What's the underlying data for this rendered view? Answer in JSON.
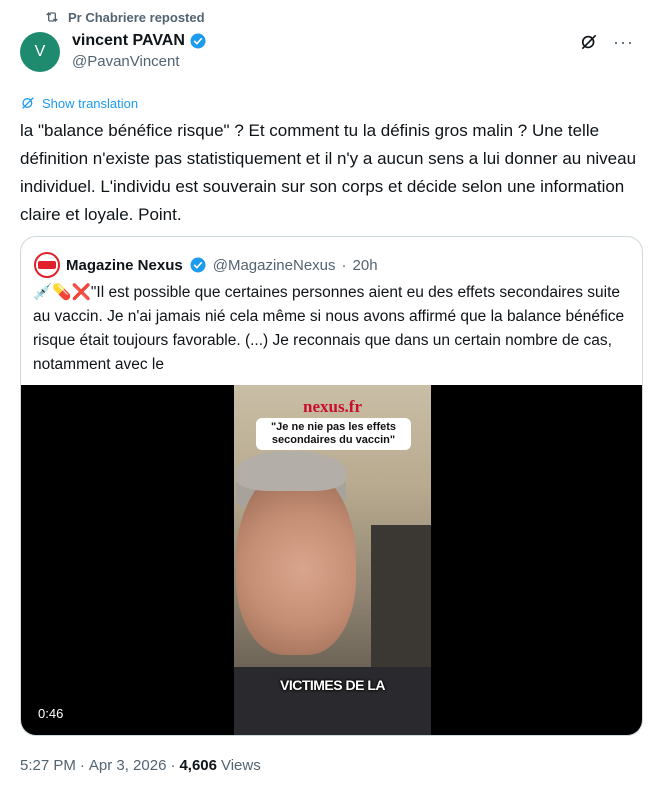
{
  "repost": {
    "text": "Pr Chabriere reposted"
  },
  "author": {
    "initial": "V",
    "name": "vincent PAVAN",
    "handle": "@PavanVincent"
  },
  "translate": {
    "label": "Show translation"
  },
  "tweet": {
    "text": "la \"balance bénéfice risque\" ? Et comment tu la définis gros malin ? Une telle définition n'existe pas statistiquement et il n'y a aucun sens a lui donner au niveau individuel. L'individu est souverain sur son corps et décide selon une information claire et loyale. Point."
  },
  "quote": {
    "name": "Magazine Nexus",
    "handle": "@MagazineNexus",
    "separator": "·",
    "time": "20h",
    "emojis": "💉💊❌",
    "text": "\"Il est possible que certaines personnes aient eu des effets secondaires suite au vaccin. Je n'ai jamais nié cela même si nous avons affirmé que la balance bénéfice risque était toujours favorable. (...) Je reconnais que dans un certain nombre de cas, notamment avec le",
    "video": {
      "logo": "nexus.fr",
      "caption": "\"Je ne nie pas les effets secondaires du vaccin\"",
      "overlay": "VICTIMES DE LA",
      "duration": "0:46"
    }
  },
  "meta": {
    "time": "5:27 PM",
    "separator": "·",
    "date": "Apr 3, 2026",
    "separator2": "·",
    "views_count": "4,606",
    "views_label": "Views"
  },
  "colors": {
    "accent": "#1d9bf0",
    "muted": "#536471",
    "text": "#0f1419",
    "border": "#cfd9de"
  },
  "icons": {
    "repost": "repost-icon",
    "verified": "verified-badge-icon",
    "grok": "grok-icon",
    "more": "more-icon",
    "translate": "translate-icon"
  }
}
